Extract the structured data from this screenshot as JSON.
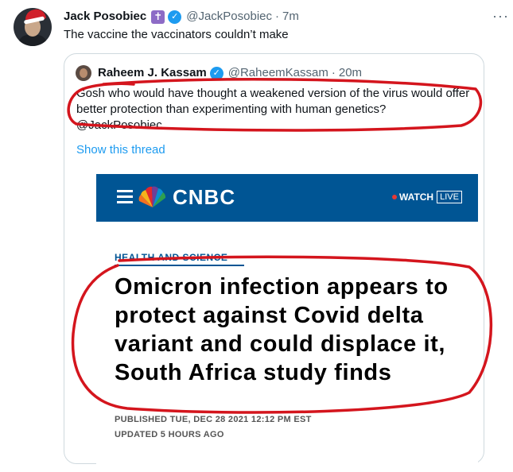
{
  "tweet": {
    "author_name": "Jack Posobiec",
    "badge_icon": "cross-badge-icon",
    "handle": "@JackPosobiec",
    "separator": "·",
    "time": "7m",
    "text": "The vaccine the vaccinators couldn’t make",
    "more_icon": "···"
  },
  "quote": {
    "author_name": "Raheem J. Kassam",
    "handle": "@RaheemKassam",
    "separator": "·",
    "time": "20m",
    "text": "Gosh who would have thought a weakened version of the virus would offer better protection than experimenting with human genetics?",
    "mention": "@JackPosobiec",
    "show_thread": "Show this thread"
  },
  "article": {
    "logo": "CNBC",
    "watch_label": "WATCH",
    "live_label": "LIVE",
    "section": "HEALTH AND SCIENCE",
    "headline": "Omicron infection appears to protect against Covid delta variant and could displace it, South Africa study finds",
    "published": "PUBLISHED TUE, DEC 28 2021 12:12 PM EST",
    "updated": "UPDATED 5 HOURS AGO"
  },
  "colors": {
    "accent": "#1d9bf0",
    "cnbc_blue": "#005594",
    "annotation_red": "#d4151d"
  }
}
